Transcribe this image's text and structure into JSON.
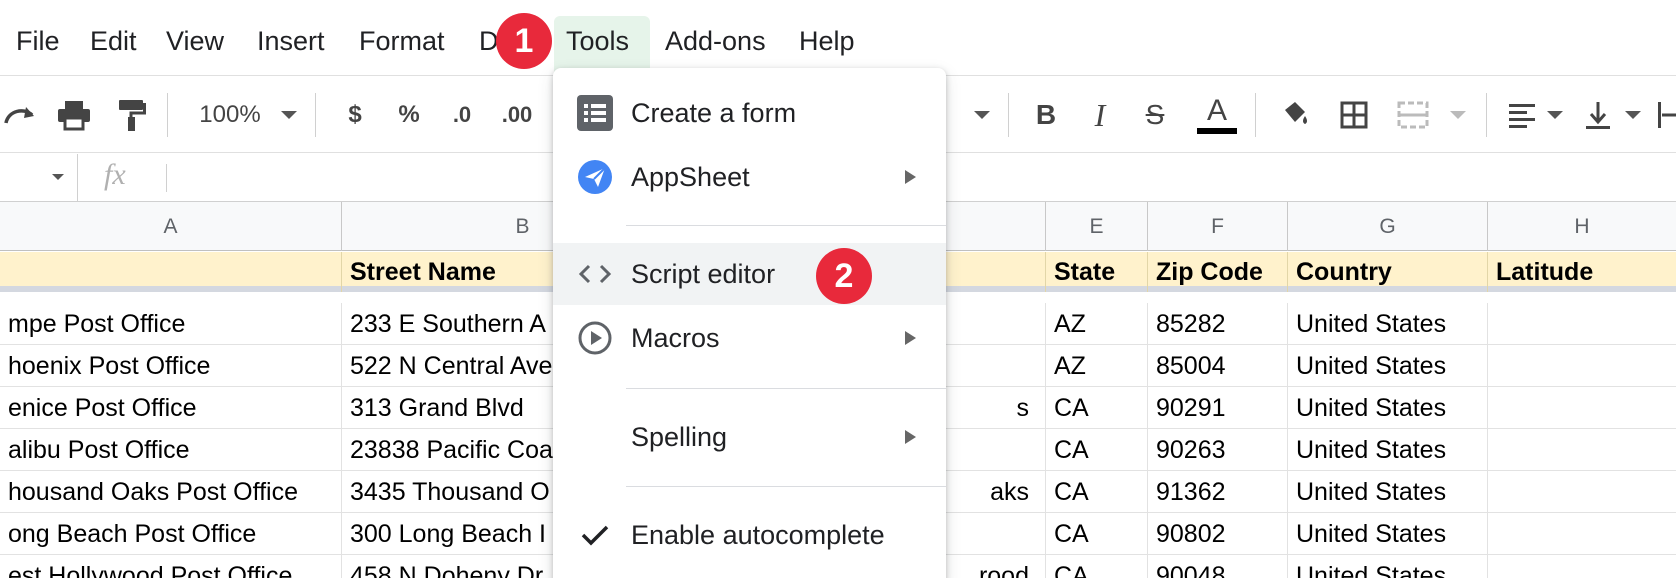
{
  "menubar": {
    "items": [
      "File",
      "Edit",
      "View",
      "Insert",
      "Format",
      "D",
      "Tools",
      "Add-ons",
      "Help"
    ]
  },
  "toolbar": {
    "zoom": "100%",
    "currency": "$",
    "percent": "%",
    "decrease_decimals": ".0",
    "increase_decimals": ".00",
    "text_color_letter": "A",
    "bold": "B",
    "italic": "I",
    "strike": "S"
  },
  "formula_bar": {
    "fx": "fx"
  },
  "grid": {
    "column_letters": [
      "A",
      "B",
      "E",
      "F",
      "G",
      "H"
    ],
    "headers": [
      "",
      "Street Name",
      "State",
      "Zip Code",
      "Country",
      "Latitude"
    ],
    "rows": [
      {
        "a": "mpe Post Office",
        "b": "233 E Southern A",
        "d": "",
        "e": "AZ",
        "f": "85282",
        "g": "United States"
      },
      {
        "a": "hoenix Post Office",
        "b": "522 N Central Ave",
        "d": "",
        "e": "AZ",
        "f": "85004",
        "g": "United States"
      },
      {
        "a": "enice Post Office",
        "b": "313 Grand Blvd",
        "d": "s",
        "e": "CA",
        "f": "90291",
        "g": "United States"
      },
      {
        "a": "alibu Post Office",
        "b": "23838 Pacific Coa",
        "d": "",
        "e": "CA",
        "f": "90263",
        "g": "United States"
      },
      {
        "a": "housand Oaks Post Office",
        "b": "3435 Thousand O",
        "d": "aks",
        "e": "CA",
        "f": "91362",
        "g": "United States"
      },
      {
        "a": "ong Beach Post Office",
        "b": "300 Long Beach I",
        "d": "",
        "e": "CA",
        "f": "90802",
        "g": "United States"
      },
      {
        "a": "est Hollywood Post Office",
        "b": "458 N Doheny Dr",
        "d": "rood",
        "e": "CA",
        "f": "90048",
        "g": "United States"
      }
    ]
  },
  "tools_menu": {
    "create_form": "Create a form",
    "appsheet": "AppSheet",
    "script_editor": "Script editor",
    "macros": "Macros",
    "spelling": "Spelling",
    "autocomplete": "Enable autocomplete"
  },
  "markers": {
    "one": "1",
    "two": "2"
  },
  "colors": {
    "marker": "#e8293b",
    "header_fill": "#fff2cc",
    "tools_active": "#e6f4ea"
  }
}
